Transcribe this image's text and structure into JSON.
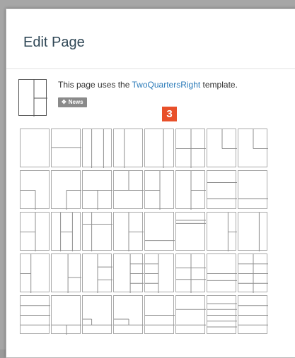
{
  "dialog": {
    "title": "Edit Page",
    "description_prefix": "This page uses the ",
    "template_name": "TwoQuartersRight",
    "description_suffix": " template.",
    "tag_label": "News",
    "callout_number": "3"
  },
  "templates": [
    "Full",
    "TwoRows",
    "ThreeColumnsNarrowSides",
    "TwoColumnsNarrowLeft",
    "TwoColumnsWideLeft",
    "Quarters",
    "QuarterTopRight",
    "QuarterTopLeft",
    "QuarterBottomLeft",
    "QuarterBottomRight",
    "TwoQuartersBottom",
    "TwoQuartersTop",
    "TwoColumnsSplitLeft",
    "TwoColumnsSplitRight",
    "ThreeRowsWideMiddle",
    "TwoRowsBottomSmall",
    "TwoQuartersLeft",
    "ThreeColumnsSplitRight",
    "ThreeColumnsSplitMiddle",
    "TwoQuartersRight",
    "BottomStrip",
    "TopStrip",
    "RightColumnSplit",
    "RightColumnNarrow",
    "LeftColumnSplit",
    "RightColumnStack",
    "ThreeRowsRight",
    "FourRowsRight",
    "FourRowsLeft",
    "FourRowsMiddle",
    "ThreeRows",
    "FourRowsSplitRight",
    "FourRows",
    "BottomQuarterLeft",
    "BottomThirdLeft",
    "BottomQuarterRight",
    "TwoRowsSmallTop",
    "TwoRowsSmallBottom",
    "ManyRows",
    "FiveRows"
  ]
}
